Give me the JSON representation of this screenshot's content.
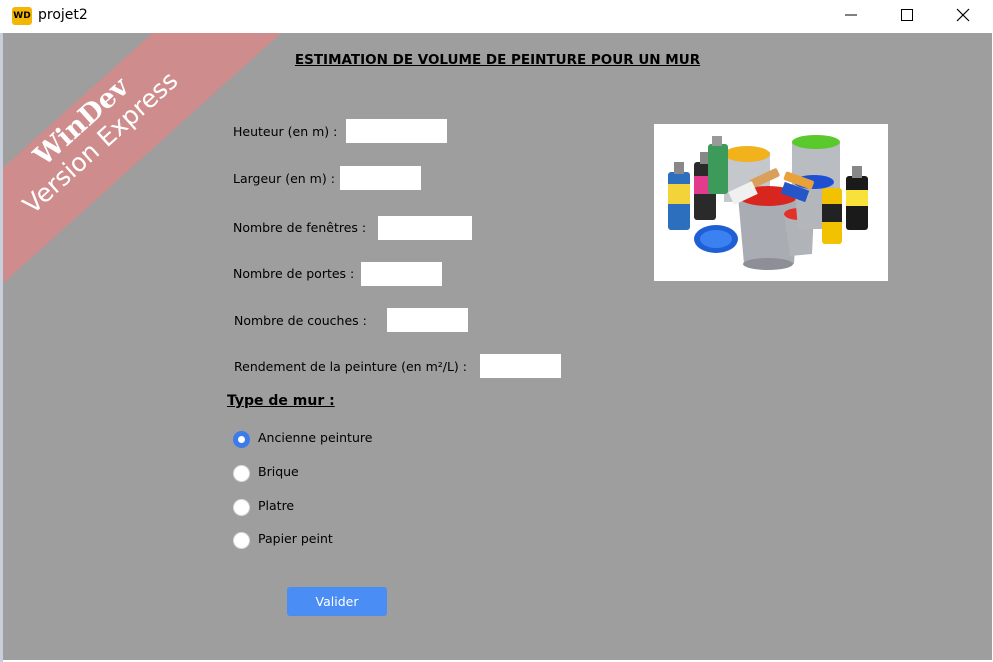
{
  "window": {
    "app_icon_text": "WD",
    "title": "projet2"
  },
  "watermark": {
    "line1": "WinDev",
    "line2": "Version Express"
  },
  "form": {
    "title": "ESTIMATION DE VOLUME DE PEINTURE POUR UN MUR",
    "fields": [
      {
        "label": "Heuteur (en m) :",
        "value": ""
      },
      {
        "label": "Largeur (en m) :",
        "value": ""
      },
      {
        "label": "Nombre de fenêtres :",
        "value": ""
      },
      {
        "label": "Nombre de portes :",
        "value": ""
      },
      {
        "label": "Nombre de couches :",
        "value": ""
      },
      {
        "label": "Rendement de la peinture (en m²/L) :",
        "value": ""
      }
    ],
    "wall_type": {
      "title": "Type de mur :",
      "options": [
        "Ancienne peinture",
        "Brique",
        "Platre",
        "Papier peint"
      ],
      "selected": "Ancienne peinture"
    },
    "submit_label": "Valider"
  },
  "colors": {
    "background": "#9e9e9e",
    "accent": "#3b7bea",
    "button": "#4a8df5",
    "watermark": "#cf8c8c"
  },
  "image": {
    "name": "paint-cans-image"
  }
}
